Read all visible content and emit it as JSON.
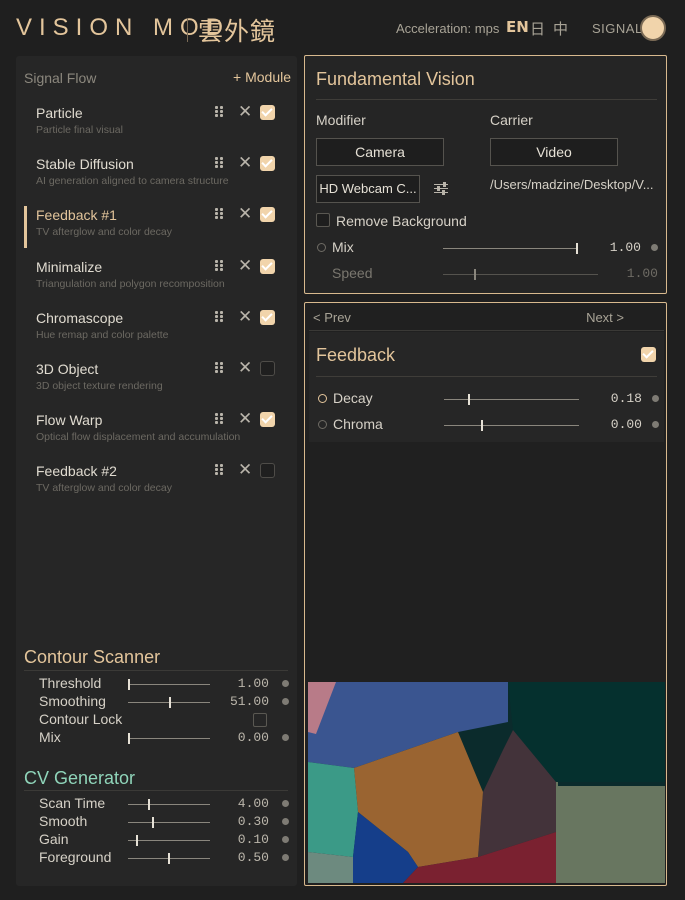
{
  "header": {
    "brand": "VISION MOD",
    "brand_cn": "雲外鏡",
    "acceleration": "Acceleration: mps",
    "languages": [
      "EN",
      "日",
      "中"
    ],
    "signal_label": "SIGNAL"
  },
  "signal_flow": {
    "title": "Signal Flow",
    "add_label": "+ Module",
    "modules": [
      {
        "name": "Particle",
        "desc": "Particle final visual",
        "enabled": true,
        "active": false
      },
      {
        "name": "Stable Diffusion",
        "desc": "AI generation aligned to camera structure",
        "enabled": true,
        "active": false
      },
      {
        "name": "Feedback #1",
        "desc": "TV afterglow and color decay",
        "enabled": true,
        "active": true
      },
      {
        "name": "Minimalize",
        "desc": "Triangulation and polygon recomposition",
        "enabled": true,
        "active": false
      },
      {
        "name": "Chromascope",
        "desc": "Hue remap and color palette",
        "enabled": true,
        "active": false
      },
      {
        "name": "3D Object",
        "desc": "3D object texture rendering",
        "enabled": false,
        "active": false
      },
      {
        "name": "Flow Warp",
        "desc": "Optical flow displacement and accumulation",
        "enabled": true,
        "active": false
      },
      {
        "name": "Feedback #2",
        "desc": "TV afterglow and color decay",
        "enabled": false,
        "active": false
      }
    ]
  },
  "contour_scanner": {
    "title": "Contour Scanner",
    "params": [
      {
        "label": "Threshold",
        "value": "1.00",
        "level": 0.0
      },
      {
        "label": "Smoothing",
        "value": "51.00",
        "level": 0.51
      },
      {
        "label": "Contour Lock",
        "value": "",
        "toggle": false
      },
      {
        "label": "Mix",
        "value": "0.00",
        "level": 0.0
      }
    ]
  },
  "cv_generator": {
    "title": "CV Generator",
    "params": [
      {
        "label": "Scan Time",
        "value": "4.00",
        "level": 0.25
      },
      {
        "label": "Smooth",
        "value": "0.30",
        "level": 0.3
      },
      {
        "label": "Gain",
        "value": "0.10",
        "level": 0.1
      },
      {
        "label": "Foreground",
        "value": "0.50",
        "level": 0.5
      }
    ]
  },
  "fundamental_vision": {
    "title": "Fundamental Vision",
    "modifier_label": "Modifier",
    "carrier_label": "Carrier",
    "modifier_button": "Camera",
    "carrier_button": "Video",
    "device_select": "HD Webcam C...",
    "carrier_path": "/Users/madzine/Desktop/V...",
    "remove_bg_label": "Remove Background",
    "mix_label": "Mix",
    "mix_value": "1.00",
    "mix_level": 1.0,
    "speed_label": "Speed",
    "speed_value": "1.00",
    "speed_level": 0.2
  },
  "feedback_panel": {
    "prev_label": "< Prev",
    "next_label": "Next >",
    "title": "Feedback",
    "enabled": true,
    "decay_label": "Decay",
    "decay_value": "0.18",
    "decay_level": 0.18,
    "chroma_label": "Chroma",
    "chroma_value": "0.00",
    "chroma_level": 0.28
  },
  "colors": {
    "accent": "#e3c59b",
    "accent_green": "#8fd4b9",
    "panel_border": "#d8b98e",
    "background": "#1f1f1f"
  }
}
